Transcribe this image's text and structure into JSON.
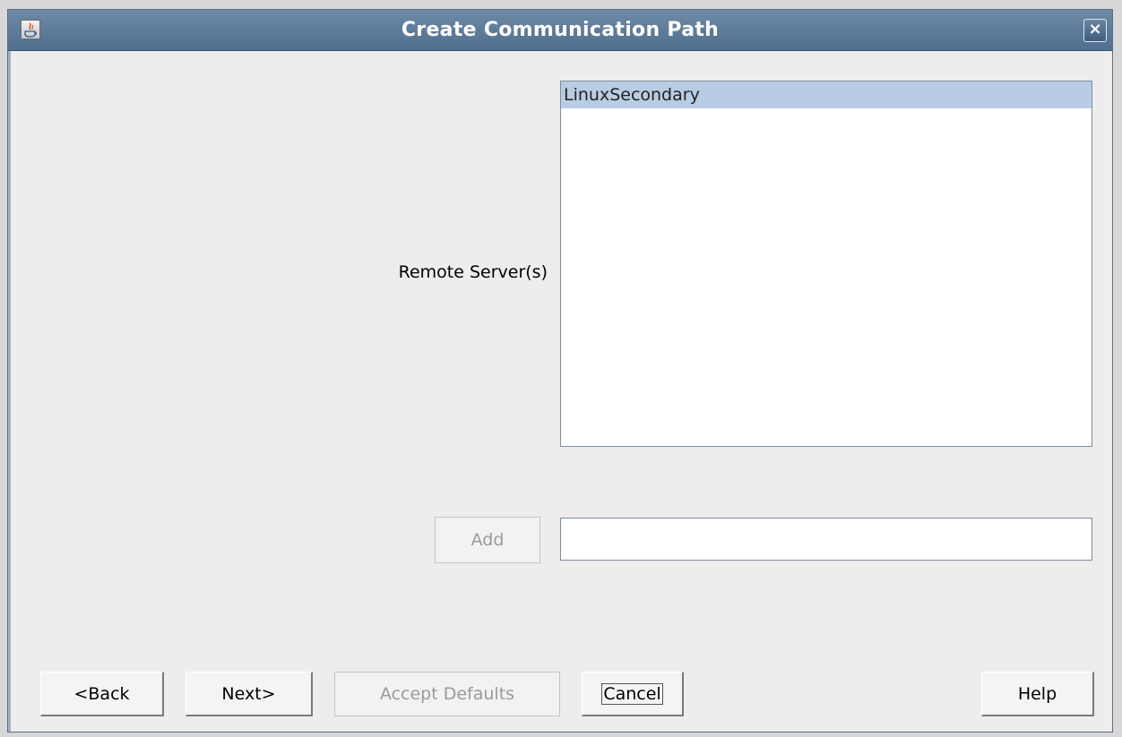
{
  "window": {
    "title": "Create Communication Path",
    "close_label": "×",
    "icon": "java-app-icon"
  },
  "form": {
    "remote_servers_label": "Remote Server(s)",
    "servers": [
      {
        "label": "LinuxSecondary",
        "selected": true
      }
    ],
    "add_label": "Add",
    "server_input_value": ""
  },
  "buttons": {
    "back": "<Back",
    "next": "Next>",
    "accept_defaults": "Accept Defaults",
    "cancel": "Cancel",
    "help": "Help"
  },
  "colors": {
    "titlebar": "#5a7896",
    "selection": "#b8cde3",
    "background": "#ededed"
  }
}
